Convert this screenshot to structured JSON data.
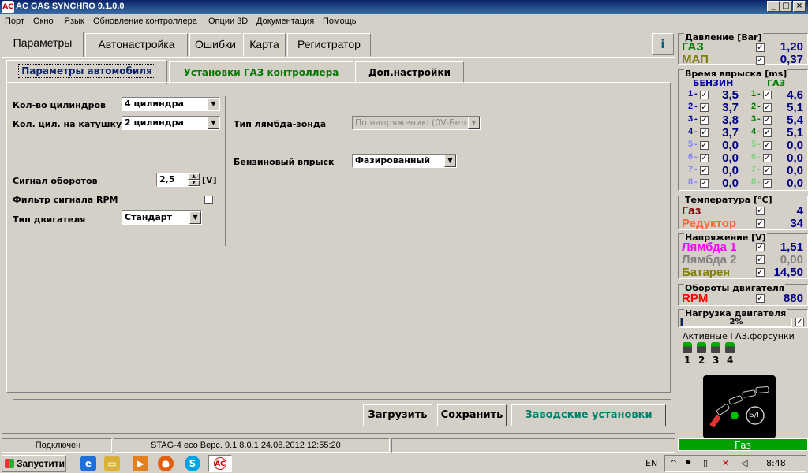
{
  "window": {
    "title": "AC GAS SYNCHRO  9.1.0.0",
    "min": "_",
    "max": "□",
    "close": "×"
  },
  "menu": [
    "Порт",
    "Окно",
    "Язык",
    "Обновление контроллера",
    "Опции 3D",
    "Документация",
    "Помощь"
  ],
  "tabs": [
    "Параметры",
    "Автонастройка",
    "Ошибки",
    "Карта",
    "Регистратор"
  ],
  "subtabs": [
    "Параметры автомобиля",
    "Установки ГАЗ контроллера",
    "Доп.настройки"
  ],
  "form": {
    "cyl_label": "Кол-во цилиндров",
    "cyl_value": "4 цилиндра",
    "coil_label": "Кол. цил. на катушку",
    "coil_value": "2 цилиндра",
    "rpm_label": "Сигнал оборотов",
    "rpm_value": "2,5",
    "rpm_unit": "[V]",
    "filter_label": "Фильтр сигнала RPM",
    "engine_label": "Тип двигателя",
    "engine_value": "Стандарт",
    "lambda_label": "Тип лямбда-зонда",
    "lambda_value": "По напряжению  (0V-Бел",
    "inj_label": "Бензиновый впрыск",
    "inj_value": "Фазированный"
  },
  "buttons": {
    "load": "Загрузить",
    "save": "Сохранить",
    "factory": "Заводские установки"
  },
  "status": {
    "conn": "Подключен",
    "device": "STAG-4 eco   Верс. 9.1  8.0.1    24.08.2012 12:55:20"
  },
  "panel": {
    "pressure_title": "Давление [Bar]",
    "gas_label": "ГАЗ",
    "gas_value": "1,20",
    "map_label": "МАП",
    "map_value": "0,37",
    "inj_title": "Время впрыска [ms]",
    "benzin_head": "БЕНЗИН",
    "gaz_head": "ГАЗ",
    "injectors": [
      {
        "n": "1",
        "p": "3,5",
        "g": "4,6"
      },
      {
        "n": "2",
        "p": "3,7",
        "g": "5,1"
      },
      {
        "n": "3",
        "p": "3,8",
        "g": "5,4"
      },
      {
        "n": "4",
        "p": "3,7",
        "g": "5,1"
      },
      {
        "n": "5",
        "p": "0,0",
        "g": "0,0"
      },
      {
        "n": "6",
        "p": "0,0",
        "g": "0,0"
      },
      {
        "n": "7",
        "p": "0,0",
        "g": "0,0"
      },
      {
        "n": "8",
        "p": "0,0",
        "g": "0,0"
      }
    ],
    "temp_title": "Температура  [°C]",
    "temp_gas_label": "Газ",
    "temp_gas_value": "4",
    "temp_red_label": "Редуктор",
    "temp_red_value": "34",
    "volt_title": "Напряжение [V]",
    "l1_label": "Лямбда 1",
    "l1_value": "1,51",
    "l2_label": "Лямбда 2",
    "l2_value": "0,00",
    "bat_label": "Батарея",
    "bat_value": "14,50",
    "rpm_title": "Обороты двигателя",
    "rpm_label": "RPM",
    "rpm_value": "880",
    "load_title": "Нагрузка двигателя",
    "load_value": "2%",
    "load_fraction": 0.02,
    "active_title": "Активные ГАЗ.форсунки",
    "active_nums": [
      "1",
      "2",
      "3",
      "4"
    ],
    "switch_label": "Б/Г",
    "mode": "Газ"
  },
  "taskbar": {
    "start": "Запустити",
    "lang": "EN",
    "time": "8:48"
  },
  "colors": {
    "gas": "#007a00",
    "map": "#808000",
    "temp_gas": "#800000",
    "reductor": "#ff6633",
    "lambda1": "#ff00ff",
    "lambda2": "#808080",
    "battery": "#808000",
    "rpm": "#ff0000",
    "mode_bg": "#00a000"
  }
}
